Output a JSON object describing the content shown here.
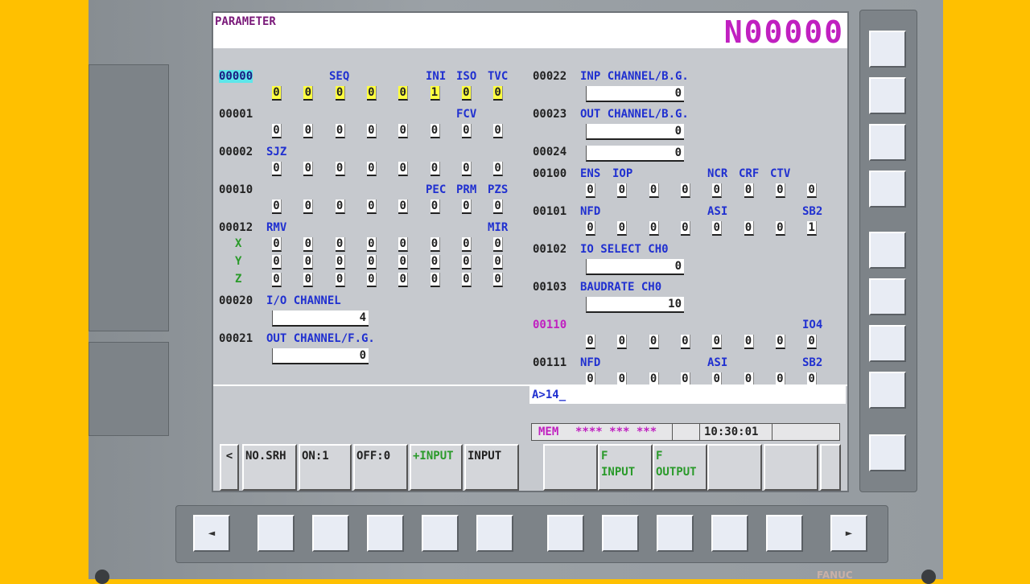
{
  "screen": {
    "title": "PARAMETER",
    "seq_number": "N00000",
    "input_buffer": "A>14_",
    "status": {
      "mode": "MEM",
      "indicators": "**** *** ***",
      "time": "10:30:01"
    }
  },
  "left_params": [
    {
      "num": "00000",
      "labels": [
        "SEQ",
        "INI",
        "ISO",
        "TVC"
      ],
      "bits": [
        "0",
        "0",
        "0",
        "0",
        "0",
        "1",
        "0",
        "0"
      ]
    },
    {
      "num": "00001",
      "labels": [
        "FCV"
      ],
      "bits": [
        "0",
        "0",
        "0",
        "0",
        "0",
        "0",
        "0",
        "0"
      ]
    },
    {
      "num": "00002",
      "labels": [
        "SJZ"
      ],
      "bits": [
        "0",
        "0",
        "0",
        "0",
        "0",
        "0",
        "0",
        "0"
      ]
    },
    {
      "num": "00010",
      "labels": [
        "PEC",
        "PRM",
        "PZS"
      ],
      "bits": [
        "0",
        "0",
        "0",
        "0",
        "0",
        "0",
        "0",
        "0"
      ]
    },
    {
      "num": "00012",
      "labels": [
        "RMV",
        "MIR"
      ],
      "axes": [
        {
          "name": "X",
          "bits": [
            "0",
            "0",
            "0",
            "0",
            "0",
            "0",
            "0",
            "0"
          ]
        },
        {
          "name": "Y",
          "bits": [
            "0",
            "0",
            "0",
            "0",
            "0",
            "0",
            "0",
            "0"
          ]
        },
        {
          "name": "Z",
          "bits": [
            "0",
            "0",
            "0",
            "0",
            "0",
            "0",
            "0",
            "0"
          ]
        }
      ]
    },
    {
      "num": "00020",
      "labels": [
        "I/O CHANNEL"
      ],
      "value": "4"
    },
    {
      "num": "00021",
      "labels": [
        "OUT CHANNEL/F.G."
      ],
      "value": "0"
    }
  ],
  "right_params": [
    {
      "num": "00022",
      "labels": [
        "INP CHANNEL/B.G."
      ],
      "value": "0"
    },
    {
      "num": "00023",
      "labels": [
        "OUT CHANNEL/B.G."
      ],
      "value": "0"
    },
    {
      "num": "00024",
      "labels": [],
      "value": "0"
    },
    {
      "num": "00100",
      "labels": [
        "ENS",
        "IOP",
        "NCR",
        "CRF",
        "CTV"
      ],
      "bits": [
        "0",
        "0",
        "0",
        "0",
        "0",
        "0",
        "0",
        "0"
      ]
    },
    {
      "num": "00101",
      "labels": [
        "NFD",
        "ASI",
        "SB2"
      ],
      "bits": [
        "0",
        "0",
        "0",
        "0",
        "0",
        "0",
        "0",
        "1"
      ]
    },
    {
      "num": "00102",
      "labels": [
        "IO SELECT CH0"
      ],
      "value": "0"
    },
    {
      "num": "00103",
      "labels": [
        "BAUDRATE CH0"
      ],
      "value": "10"
    },
    {
      "num": "00110",
      "labels": [
        "IO4"
      ],
      "bits": [
        "0",
        "0",
        "0",
        "0",
        "0",
        "0",
        "0",
        "0"
      ]
    },
    {
      "num": "00111",
      "labels": [
        "NFD",
        "ASI",
        "SB2"
      ],
      "bits": [
        "0",
        "0",
        "0",
        "0",
        "0",
        "0",
        "0",
        "0"
      ]
    }
  ],
  "softkeys": {
    "left_arrow": "<",
    "no_srh": "NO.SRH",
    "on1": "ON:1",
    "off0": "OFF:0",
    "plus_input": "+INPUT",
    "input": "INPUT",
    "f_input": "F\nINPUT",
    "f_output": "F\nOUTPUT"
  },
  "bottom_keys": {
    "left_arrow": "◄",
    "right_arrow": "►"
  },
  "colors": {
    "housing": "#FFC000",
    "bezel": "#8f959a",
    "screen_bg": "#c6c9ce",
    "label_blue": "#2030d0",
    "highlight_cyan": "#5ee6ea",
    "bit_highlight": "#ffff40",
    "magenta": "#c020c0"
  },
  "brand": "FANUC"
}
